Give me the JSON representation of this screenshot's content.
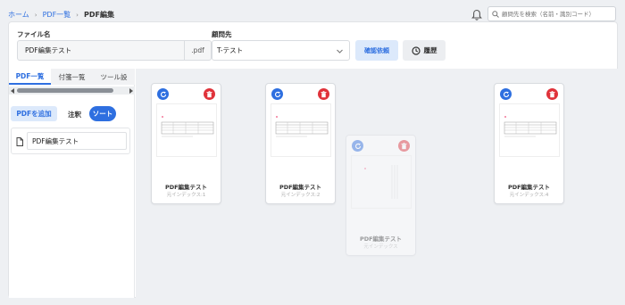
{
  "breadcrumb": {
    "home": "ホーム",
    "list": "PDF一覧",
    "current": "PDF編集"
  },
  "search": {
    "placeholder": "顧問先を検索（名前・識別コード）"
  },
  "form": {
    "filename_label": "ファイル名",
    "filename_value": "PDF編集テスト",
    "filename_ext": ".pdf",
    "client_label": "顧問先",
    "client_value": "T-テスト",
    "confirm_button": "確認依頼",
    "history_button": "履歴"
  },
  "sidebar": {
    "tabs": [
      {
        "label": "PDF一覧",
        "active": true
      },
      {
        "label": "付箋一覧",
        "active": false
      },
      {
        "label": "ツール設",
        "active": false
      }
    ],
    "add_button": "PDFを追加",
    "sort_label": "注釈",
    "sort_toggle": "ソート",
    "files": [
      {
        "name": "PDF編集テスト"
      }
    ]
  },
  "pages": [
    {
      "name": "PDF編集テスト",
      "index": "元インデックス:1",
      "dragging": false
    },
    {
      "name": "PDF編集テスト",
      "index": "元インデックス:2",
      "dragging": false
    },
    {
      "name": "PDF編集テスト",
      "index": "元インデックス",
      "dragging": true
    },
    {
      "name": "PDF編集テスト",
      "index": "元インデックス:4",
      "dragging": false
    }
  ],
  "colors": {
    "accent": "#2e6fe0",
    "danger": "#e0323a",
    "canvas_bg": "#eef0f3"
  },
  "icons": [
    "bell-icon",
    "search-icon",
    "chevron-down-icon",
    "clock-icon",
    "document-icon",
    "rotate-icon",
    "trash-icon"
  ]
}
